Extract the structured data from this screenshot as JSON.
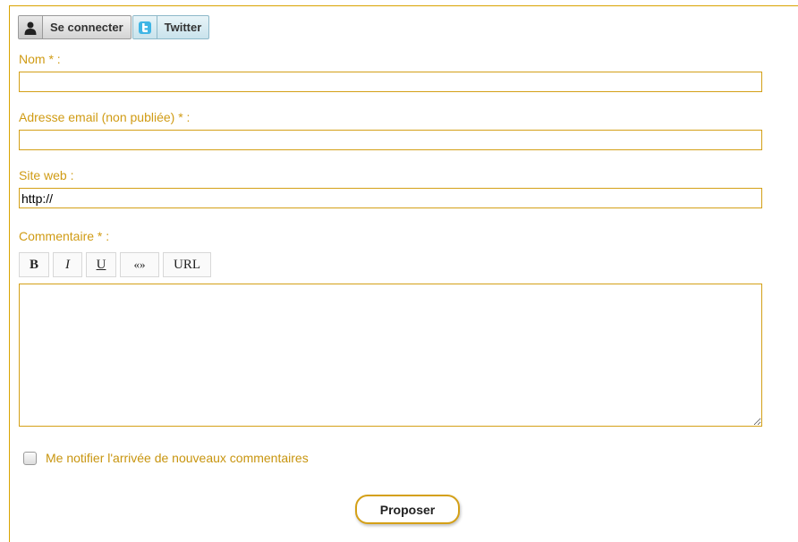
{
  "login": {
    "connect_label": "Se connecter",
    "twitter_label": "Twitter"
  },
  "form": {
    "name_label": "Nom * :",
    "name_value": "",
    "email_label": "Adresse email (non publiée) * :",
    "email_value": "",
    "site_label": "Site web :",
    "site_value": "http://",
    "comment_label": "Commentaire * :",
    "comment_value": ""
  },
  "editor": {
    "bold": "B",
    "italic": "I",
    "underline": "U",
    "quote": "«»",
    "url": "URL"
  },
  "notify_label": "Me notifier l'arrivée de nouveaux commentaires",
  "submit_label": "Proposer",
  "colors": {
    "accent": "#d4a017",
    "label_text": "#d09b14"
  },
  "icons": {
    "connect": "user-silhouette-icon",
    "twitter": "twitter-t-icon"
  }
}
